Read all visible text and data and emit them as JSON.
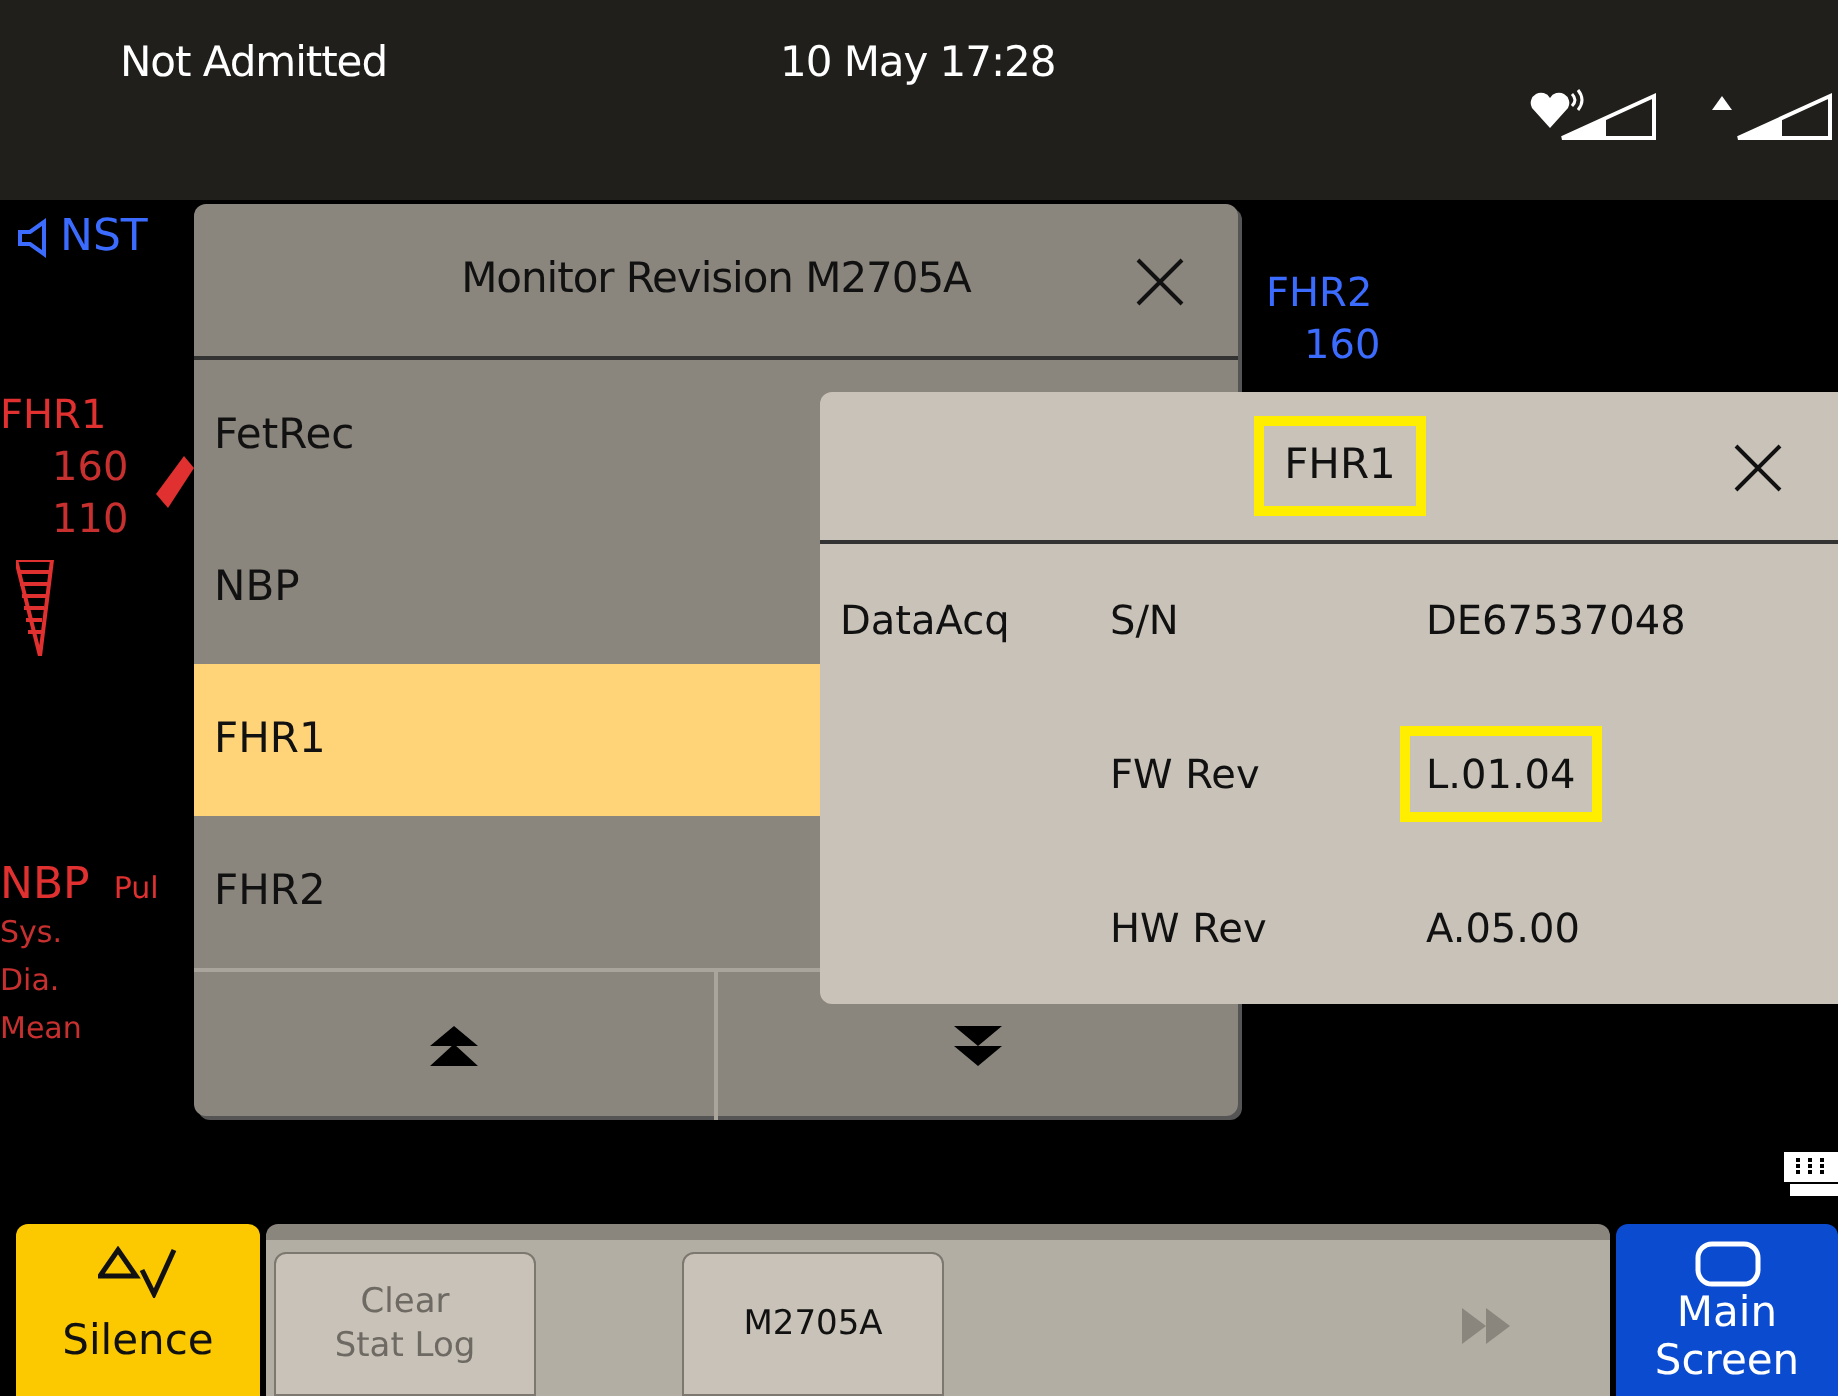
{
  "status_bar": {
    "patient": "Not Admitted",
    "datetime": "10 May 17:28"
  },
  "background": {
    "mode": "NST",
    "fhr1": {
      "label": "FHR1",
      "upper": "160",
      "lower": "110"
    },
    "nbp": {
      "label": "NBP",
      "pulse_label": "Pul",
      "rows": [
        "Sys.",
        "Dia.",
        "Mean"
      ]
    },
    "fhr2": {
      "label": "FHR2",
      "upper": "160"
    }
  },
  "revision_dialog": {
    "title": "Monitor Revision M2705A",
    "items": [
      {
        "label": "FetRec",
        "selected": false
      },
      {
        "label": "NBP",
        "selected": false
      },
      {
        "label": "FHR1",
        "selected": true
      },
      {
        "label": "FHR2",
        "selected": false
      }
    ]
  },
  "detail_dialog": {
    "title": "FHR1",
    "title_highlighted": true,
    "group": "DataAcq",
    "rows": [
      {
        "label": "S/N",
        "value": "DE67537048",
        "highlighted": false
      },
      {
        "label": "FW Rev",
        "value": "L.01.04",
        "highlighted": true
      },
      {
        "label": "HW Rev",
        "value": "A.05.00",
        "highlighted": false
      }
    ]
  },
  "bottom_bar": {
    "silence": "Silence",
    "keys": [
      {
        "label": "Clear Stat Log",
        "disabled": true
      },
      {
        "label": "M2705A",
        "disabled": false
      }
    ],
    "main_screen": "Main Screen"
  }
}
